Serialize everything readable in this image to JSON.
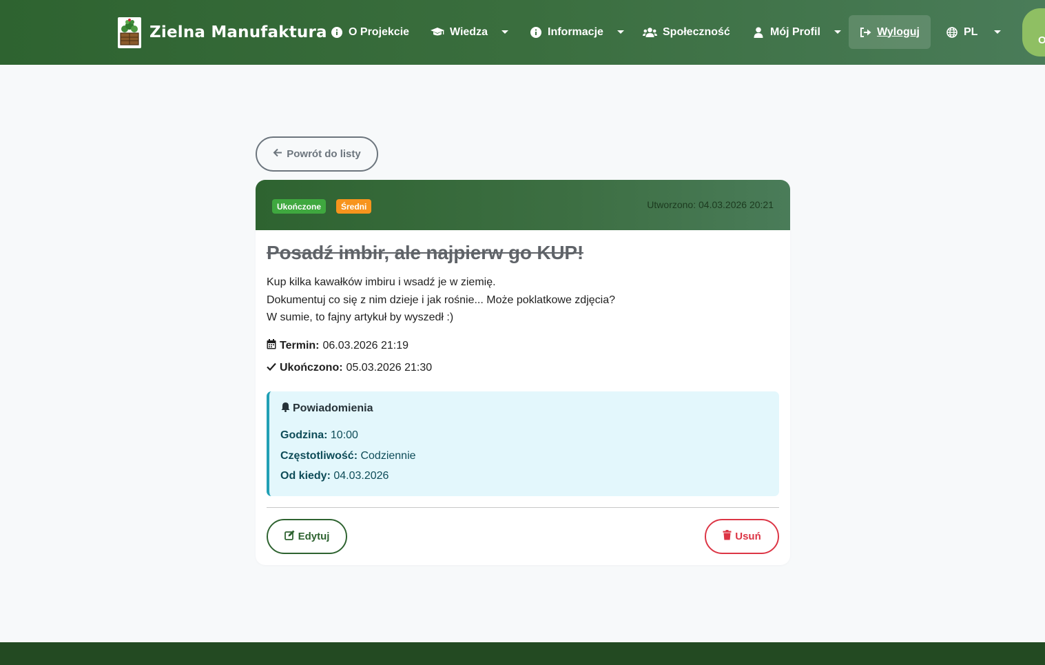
{
  "brand": {
    "name": "Zielna Manufaktura",
    "logo_icon": "herb-crate-icon"
  },
  "nav": {
    "items": [
      {
        "label": "O Projekcie",
        "icon": "info-circle-icon"
      },
      {
        "label": "Wiedza",
        "icon": "graduation-cap-icon"
      },
      {
        "label": "Informacje",
        "icon": "info-circle-icon"
      },
      {
        "label": "Społeczność",
        "icon": "users-icon"
      },
      {
        "label": "Mój Profil",
        "icon": "user-icon"
      },
      {
        "label": "Wyloguj",
        "icon": "sign-out-icon"
      },
      {
        "label": "PL",
        "icon": "globe-icon"
      }
    ],
    "extra_pill_text": "O"
  },
  "back_button": {
    "label": "Powrót do listy",
    "icon": "arrow-left-icon"
  },
  "task": {
    "status_badge": "Ukończone",
    "priority_badge": "Średni",
    "created": "Utworzono: 04.03.2026 20:21",
    "title": "Posadź imbir, ale najpierw go KUP!",
    "description": [
      "Kup kilka kawałków imbiru i wsadź je w ziemię.",
      "Dokumentuj co się z nim dzieje i jak rośnie... Może poklatkowe zdjęcia?",
      "W sumie, to fajny artykuł by wyszedł :)"
    ],
    "deadline_label": "Termin:",
    "deadline_value": "06.03.2026 21:19",
    "completed_label": "Ukończono:",
    "completed_value": "05.03.2026 21:30"
  },
  "notifications": {
    "title": "Powiadomienia",
    "hour_label": "Godzina:",
    "hour_value": "10:00",
    "frequency_label": "Częstotliwość:",
    "frequency_value": "Codziennie",
    "since_label": "Od kiedy:",
    "since_value": "04.03.2026"
  },
  "actions": {
    "edit_label": "Edytuj",
    "delete_label": "Usuń"
  },
  "colors": {
    "brand_green": "#2e6330",
    "accent_green": "#4a7c59",
    "badge_done": "#3fa83f",
    "badge_medium": "#f7941d",
    "danger": "#dc3545",
    "info_bg": "#e3f7fc",
    "info_border": "#21a0b5"
  }
}
